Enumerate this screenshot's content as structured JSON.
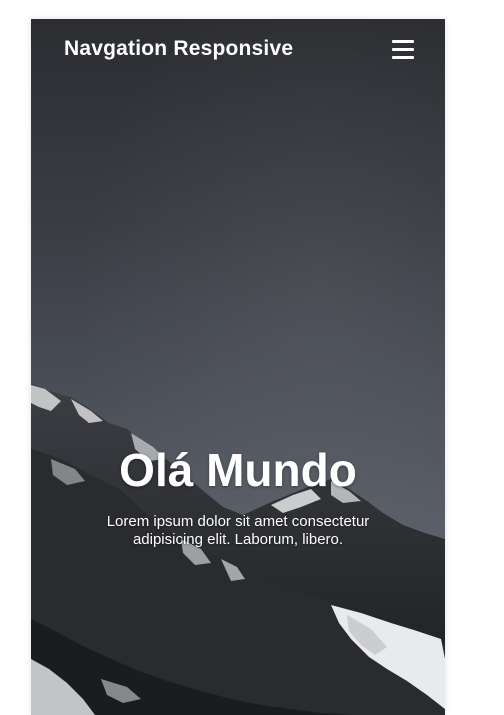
{
  "navbar": {
    "brand": "Navgation Responsive",
    "menu_icon": "hamburger-menu-icon"
  },
  "hero": {
    "title": "Olá Mundo",
    "subtitle": "Lorem ipsum dolor sit amet consectetur adipisicing elit. Laborum, libero."
  },
  "background": {
    "image": "snowy-mountain-photo",
    "sky_top_color": "#2b2d31",
    "sky_bottom_color": "#6b7078"
  }
}
